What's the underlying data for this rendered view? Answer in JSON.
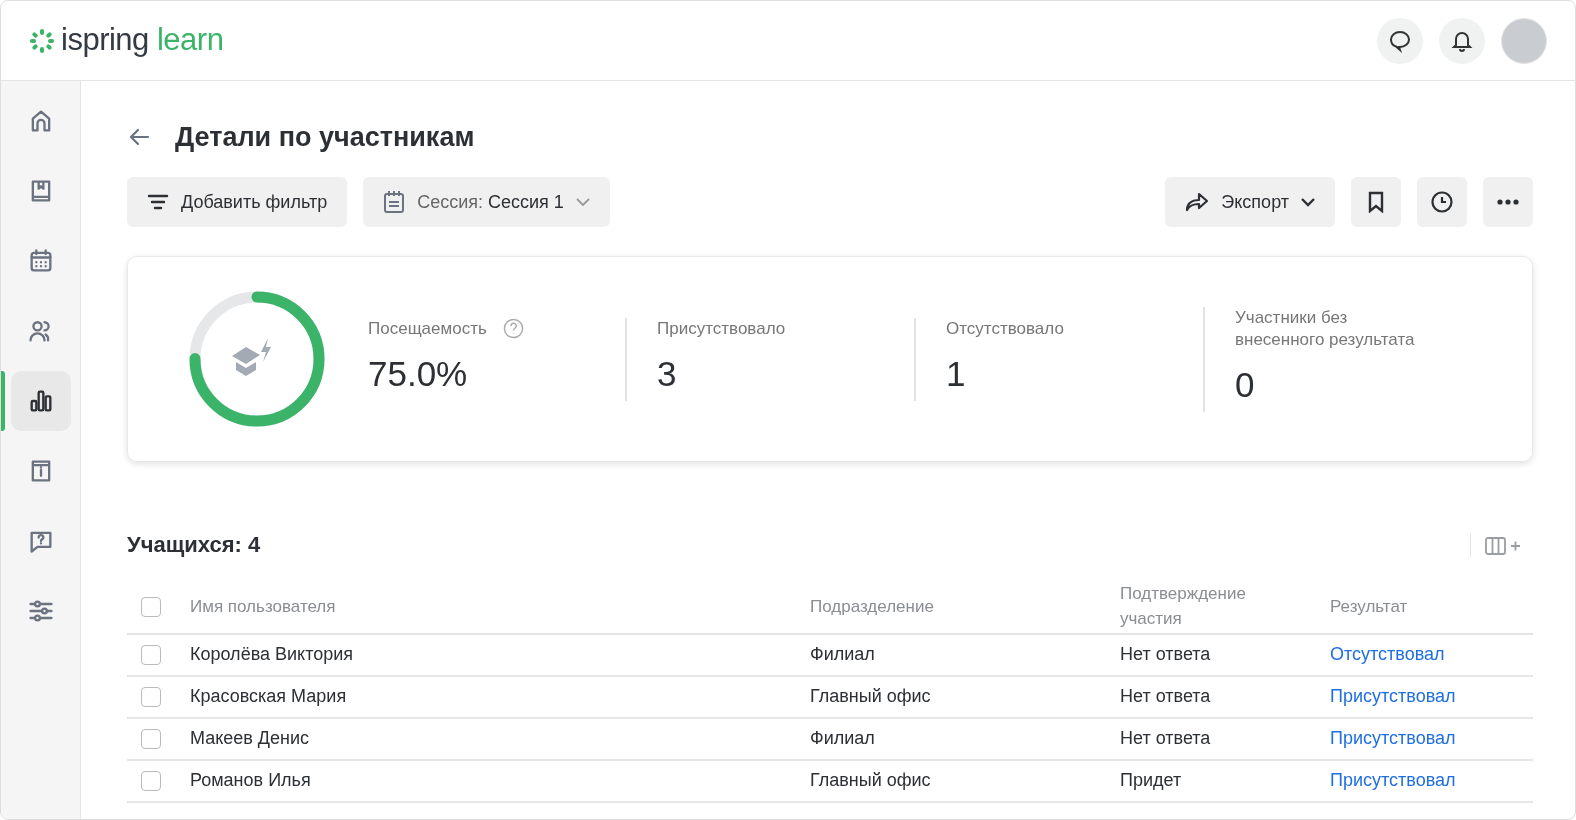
{
  "logo": {
    "name": "ispring",
    "suffix": "learn"
  },
  "sidebar": {
    "items": [
      {
        "kind": "home",
        "selected": false
      },
      {
        "kind": "book",
        "selected": false
      },
      {
        "kind": "calendar",
        "selected": false
      },
      {
        "kind": "users",
        "selected": false
      },
      {
        "kind": "chart",
        "selected": true
      },
      {
        "kind": "info",
        "selected": false
      },
      {
        "kind": "help",
        "selected": false
      },
      {
        "kind": "sliders",
        "selected": false
      }
    ]
  },
  "page": {
    "title": "Детали по участникам"
  },
  "toolbar": {
    "filter_button": "Добавить фильтр",
    "session_label": "Сессия:",
    "session_value": "Сессия 1",
    "export_button": "Экспорт"
  },
  "summary": {
    "level": 0.75,
    "stats": [
      {
        "label": "Посещаемость",
        "value": "75.0%",
        "help": true
      },
      {
        "label": "Присутствовало",
        "value": "3",
        "help": false
      },
      {
        "label": "Отсутствовало",
        "value": "1",
        "help": false
      },
      {
        "label": "Участники без внесенного результата",
        "value": "0",
        "help": false
      }
    ]
  },
  "table": {
    "count_label": "Учащихся: 4",
    "select_all_checked": false,
    "columns": [
      "Имя пользователя",
      "Подразделение",
      "Подтверждение участия",
      "Результат"
    ],
    "rows": [
      {
        "checked": false,
        "cells": [
          "Королёва Виктория",
          "Филиал",
          "Нет ответа",
          "Отсутствовал"
        ]
      },
      {
        "checked": false,
        "cells": [
          "Красовская Мария",
          "Главный офис",
          "Нет ответа",
          "Присутствовал"
        ]
      },
      {
        "checked": false,
        "cells": [
          "Макеев Денис",
          "Филиал",
          "Нет ответа",
          "Присутствовал"
        ]
      },
      {
        "checked": false,
        "cells": [
          "Романов Илья",
          "Главный офис",
          "Придет",
          "Присутствовал"
        ]
      }
    ]
  }
}
